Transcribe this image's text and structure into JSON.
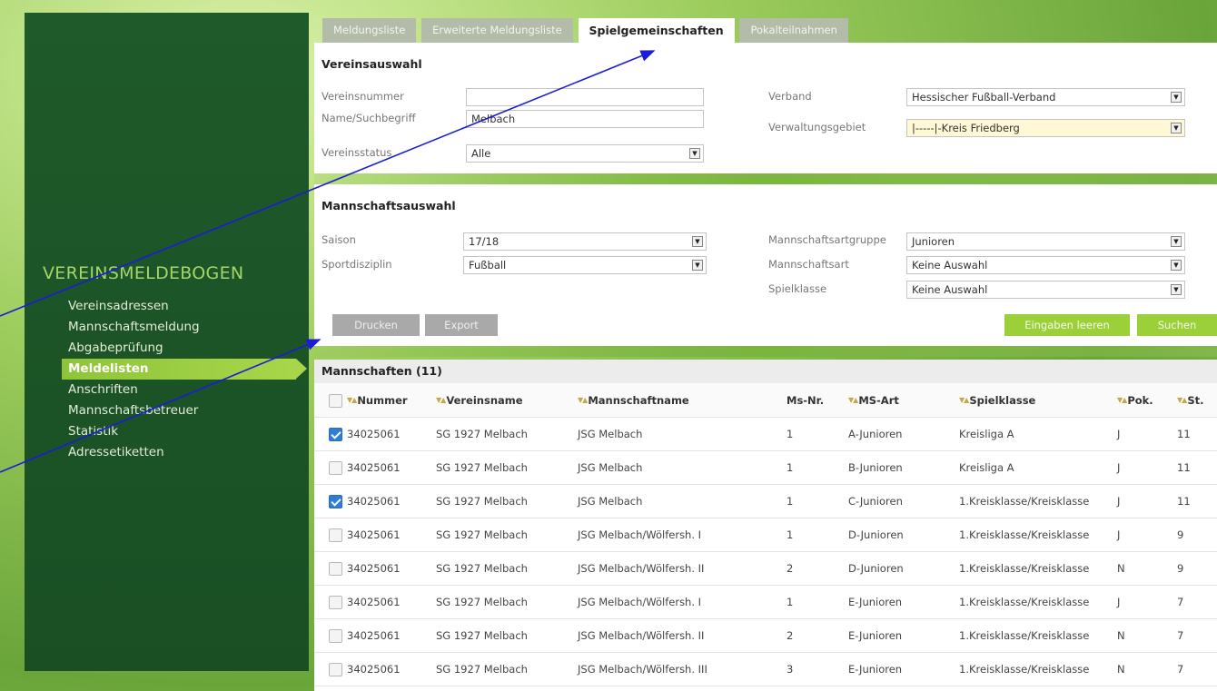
{
  "tabs": [
    "Meldungsliste",
    "Erweiterte Meldungsliste",
    "Spielgemeinschaften",
    "Pokalteilnahmen"
  ],
  "active_tab": 2,
  "sidebar": {
    "title": "VEREINSMELDEBOGEN",
    "items": [
      "Vereinsadressen",
      "Mannschaftsmeldung",
      "Abgabeprüfung",
      "Meldelisten",
      "Anschriften",
      "Mannschaftsbetreuer",
      "Statistik",
      "Adressetiketten"
    ],
    "active_index": 3
  },
  "vereinsauswahl": {
    "title": "Vereinsauswahl",
    "vereinsnummer_label": "Vereinsnummer",
    "vereinsnummer_value": "",
    "name_label": "Name/Suchbegriff",
    "name_value": "Melbach",
    "status_label": "Vereinsstatus",
    "status_value": "Alle",
    "verband_label": "Verband",
    "verband_value": "Hessischer Fußball-Verband",
    "gebiet_label": "Verwaltungsgebiet",
    "gebiet_value": "|-----|-Kreis Friedberg"
  },
  "mannschaftsauswahl": {
    "title": "Mannschaftsauswahl",
    "saison_label": "Saison",
    "saison_value": "17/18",
    "sport_label": "Sportdisziplin",
    "sport_value": "Fußball",
    "artgruppe_label": "Mannschaftsartgruppe",
    "artgruppe_value": "Junioren",
    "art_label": "Mannschaftsart",
    "art_value": "Keine Auswahl",
    "klasse_label": "Spielklasse",
    "klasse_value": "Keine Auswahl"
  },
  "buttons": {
    "drucken": "Drucken",
    "export": "Export",
    "leeren": "Eingaben leeren",
    "suchen": "Suchen"
  },
  "table": {
    "title": "Mannschaften (11)",
    "columns": [
      "Nummer",
      "Vereinsname",
      "Mannschaftname",
      "Ms-Nr.",
      "MS-Art",
      "Spielklasse",
      "Pok.",
      "St."
    ],
    "rows": [
      {
        "checked": true,
        "cells": [
          "34025061",
          "SG 1927 Melbach",
          "JSG Melbach",
          "1",
          "A-Junioren",
          "Kreisliga A",
          "J",
          "11"
        ]
      },
      {
        "checked": false,
        "cells": [
          "34025061",
          "SG 1927 Melbach",
          "JSG Melbach",
          "1",
          "B-Junioren",
          "Kreisliga A",
          "J",
          "11"
        ]
      },
      {
        "checked": true,
        "cells": [
          "34025061",
          "SG 1927 Melbach",
          "JSG Melbach",
          "1",
          "C-Junioren",
          "1.Kreisklasse/Kreisklasse",
          "J",
          "11"
        ]
      },
      {
        "checked": false,
        "cells": [
          "34025061",
          "SG 1927 Melbach",
          "JSG Melbach/Wölfersh. I",
          "1",
          "D-Junioren",
          "1.Kreisklasse/Kreisklasse",
          "J",
          "9"
        ]
      },
      {
        "checked": false,
        "cells": [
          "34025061",
          "SG 1927 Melbach",
          "JSG Melbach/Wölfersh. II",
          "2",
          "D-Junioren",
          "1.Kreisklasse/Kreisklasse",
          "N",
          "9"
        ]
      },
      {
        "checked": false,
        "cells": [
          "34025061",
          "SG 1927 Melbach",
          "JSG Melbach/Wölfersh. I",
          "1",
          "E-Junioren",
          "1.Kreisklasse/Kreisklasse",
          "J",
          "7"
        ]
      },
      {
        "checked": false,
        "cells": [
          "34025061",
          "SG 1927 Melbach",
          "JSG Melbach/Wölfersh. II",
          "2",
          "E-Junioren",
          "1.Kreisklasse/Kreisklasse",
          "N",
          "7"
        ]
      },
      {
        "checked": false,
        "cells": [
          "34025061",
          "SG 1927 Melbach",
          "JSG Melbach/Wölfersh. III",
          "3",
          "E-Junioren",
          "1.Kreisklasse/Kreisklasse",
          "N",
          "7"
        ]
      }
    ]
  },
  "colors": {
    "sidebar_bg": "#1f5a2a",
    "accent_green": "#9bd03a",
    "arrow": "#1c1cd8",
    "checkbox_checked": "#2f7cd6"
  }
}
